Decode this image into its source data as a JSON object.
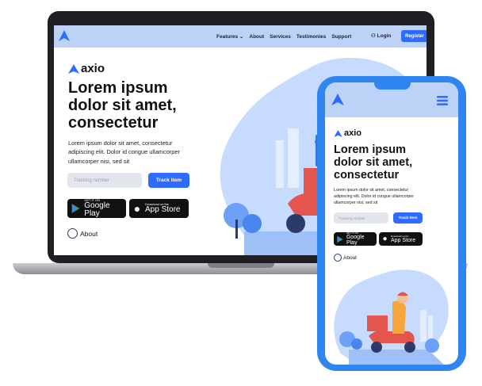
{
  "nav": {
    "links": [
      "Features",
      "About",
      "Services",
      "Testimonies",
      "Support"
    ],
    "login": "Login",
    "register": "Register"
  },
  "brand": {
    "name": "axio"
  },
  "hero": {
    "headline_1": "Lorem ipsum",
    "headline_2": "dolor sit amet,",
    "headline_3": "consectetur",
    "paragraph_1": "Lorem ipsum dolor sit amet, consectetur",
    "paragraph_2": "adipiscing elit. Dolor id congue ullamcorper",
    "paragraph_3": "ullamcorper nisi, sed sit",
    "tracking_placeholder": "Tracking number",
    "track_button": "Track Item",
    "about_label": "About"
  },
  "stores": {
    "google_small": "GET IT ON",
    "google_big": "Google Play",
    "apple_small": "Download on the",
    "apple_big": "App Store"
  },
  "colors": {
    "accent": "#2f6bff",
    "nav_bg": "#bcd3f7",
    "phone_body": "#2f86f0",
    "blob": "#c7dbff"
  }
}
